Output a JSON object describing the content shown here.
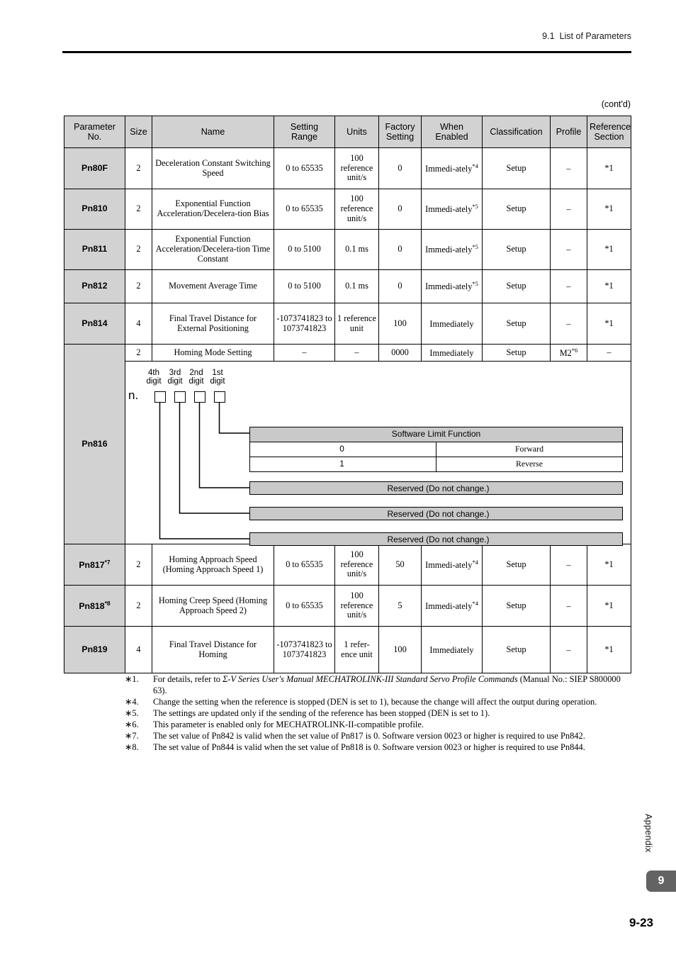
{
  "header": {
    "section_number": "9.1",
    "section_title": "List of Parameters"
  },
  "continued_label": "(cont'd)",
  "table": {
    "columns": [
      "Parameter\nNo.",
      "Size",
      "Name",
      "Setting\nRange",
      "Units",
      "Factory\nSetting",
      "When\nEnabled",
      "Classification",
      "Profile",
      "Reference\nSection"
    ],
    "columns_flat": {
      "parameter_no_line1": "Parameter",
      "parameter_no_line2": "No.",
      "size": "Size",
      "name": "Name",
      "setting_range_line1": "Setting",
      "setting_range_line2": "Range",
      "units": "Units",
      "factory_setting_line1": "Factory",
      "factory_setting_line2": "Setting",
      "when_enabled_line1": "When",
      "when_enabled_line2": "Enabled",
      "classification": "Classification",
      "profile": "Profile",
      "reference_section_line1": "Reference",
      "reference_section_line2": "Section"
    },
    "rows": [
      {
        "parameter_no": "Pn80F",
        "footnote_marker": "",
        "size": "2",
        "name": "Deceleration Constant Switching Speed",
        "setting_range": "0 to 65535",
        "units": "100 reference unit/s",
        "factory_setting": "0",
        "when_enabled": "Immedi-ately",
        "when_enabled_footnote": "*4",
        "classification": "Setup",
        "profile": "–",
        "profile_footnote": "",
        "reference_section": "*1"
      },
      {
        "parameter_no": "Pn810",
        "footnote_marker": "",
        "size": "2",
        "name": "Exponential Function Acceleration/Decelera-tion Bias",
        "setting_range": "0 to 65535",
        "units": "100 reference unit/s",
        "factory_setting": "0",
        "when_enabled": "Immedi-ately",
        "when_enabled_footnote": "*5",
        "classification": "Setup",
        "profile": "–",
        "profile_footnote": "",
        "reference_section": "*1"
      },
      {
        "parameter_no": "Pn811",
        "footnote_marker": "",
        "size": "2",
        "name": "Exponential Function Acceleration/Decelera-tion Time Constant",
        "setting_range": "0 to 5100",
        "units": "0.1 ms",
        "factory_setting": "0",
        "when_enabled": "Immedi-ately",
        "when_enabled_footnote": "*5",
        "classification": "Setup",
        "profile": "–",
        "profile_footnote": "",
        "reference_section": "*1"
      },
      {
        "parameter_no": "Pn812",
        "footnote_marker": "",
        "size": "2",
        "name": "Movement Average Time",
        "setting_range": "0 to 5100",
        "units": "0.1 ms",
        "factory_setting": "0",
        "when_enabled": "Immedi-ately",
        "when_enabled_footnote": "*5",
        "classification": "Setup",
        "profile": "–",
        "profile_footnote": "",
        "reference_section": "*1"
      },
      {
        "parameter_no": "Pn814",
        "footnote_marker": "",
        "size": "4",
        "name": "Final Travel Distance for External Positioning",
        "setting_range": "-1073741823 to 1073741823",
        "units": "1 reference unit",
        "factory_setting": "100",
        "when_enabled": "Immediately",
        "when_enabled_footnote": "",
        "classification": "Setup",
        "profile": "–",
        "profile_footnote": "",
        "reference_section": "*1"
      },
      {
        "parameter_no": "Pn816",
        "footnote_marker": "",
        "size": "2",
        "name": "Homing Mode Setting",
        "setting_range": "–",
        "units": "–",
        "factory_setting": "0000",
        "when_enabled": "Immediately",
        "when_enabled_footnote": "",
        "classification": "Setup",
        "profile": "M2",
        "profile_footnote": "*6",
        "reference_section": "–"
      },
      {
        "parameter_no": "Pn817",
        "footnote_marker": "*7",
        "size": "2",
        "name": "Homing Approach Speed (Homing Approach Speed 1)",
        "setting_range": "0 to 65535",
        "units": "100 reference unit/s",
        "factory_setting": "50",
        "when_enabled": "Immedi-ately",
        "when_enabled_footnote": "*4",
        "classification": "Setup",
        "profile": "–",
        "profile_footnote": "",
        "reference_section": "*1"
      },
      {
        "parameter_no": "Pn818",
        "footnote_marker": "*8",
        "size": "2",
        "name": "Homing Creep Speed (Homing Approach Speed 2)",
        "setting_range": "0 to 65535",
        "units": "100 reference unit/s",
        "factory_setting": "5",
        "when_enabled": "Immedi-ately",
        "when_enabled_footnote": "*4",
        "classification": "Setup",
        "profile": "–",
        "profile_footnote": "",
        "reference_section": "*1"
      },
      {
        "parameter_no": "Pn819",
        "footnote_marker": "",
        "size": "4",
        "name": "Final Travel Distance for Homing",
        "setting_range": "-1073741823 to 1073741823",
        "units": "1 refer-ence unit",
        "factory_setting": "100",
        "when_enabled": "Immediately",
        "when_enabled_footnote": "",
        "classification": "Setup",
        "profile": "–",
        "profile_footnote": "",
        "reference_section": "*1"
      }
    ]
  },
  "digit_diagram": {
    "prefix": "n.",
    "digit_labels": [
      {
        "ordinal": "4th",
        "word": "digit"
      },
      {
        "ordinal": "3rd",
        "word": "digit"
      },
      {
        "ordinal": "2nd",
        "word": "digit"
      },
      {
        "ordinal": "1st",
        "word": "digit"
      }
    ],
    "first_digit": {
      "title": "Software Limit Function",
      "options": [
        {
          "value": "0",
          "description": "Forward"
        },
        {
          "value": "1",
          "description": "Reverse"
        }
      ]
    },
    "second_digit": {
      "title": "Reserved (Do not change.)"
    },
    "third_digit": {
      "title": "Reserved (Do not change.)"
    },
    "fourth_digit": {
      "title": "Reserved (Do not change.)"
    }
  },
  "footnotes": [
    {
      "marker": "∗1.",
      "text_before": "For details, refer to ",
      "italic": "Σ-V Series User's Manual MECHATROLINK-III Standard Servo Profile Commands",
      "text_after": " (Manual No.: SIEP S800000 63)."
    },
    {
      "marker": "∗4.",
      "text_before": "Change the setting when the reference is stopped (DEN is set to 1), because the change will affect the output during operation.",
      "italic": "",
      "text_after": ""
    },
    {
      "marker": "∗5.",
      "text_before": "The settings are updated only if the sending of the reference has been stopped (DEN is set to 1).",
      "italic": "",
      "text_after": ""
    },
    {
      "marker": "∗6.",
      "text_before": "This parameter is enabled only for MECHATROLINK-II-compatible profile.",
      "italic": "",
      "text_after": ""
    },
    {
      "marker": "∗7.",
      "text_before": "The set value of Pn842 is valid when the set value of Pn817 is 0. Software version 0023 or higher is required to use Pn842.",
      "italic": "",
      "text_after": ""
    },
    {
      "marker": "∗8.",
      "text_before": "The set value of Pn844 is valid when the set value of Pn818 is 0. Software version 0023 or higher is required to use Pn844.",
      "italic": "",
      "text_after": ""
    }
  ],
  "sidebar": {
    "appendix_label": "Appendix",
    "chapter_tab": "9",
    "page_number": "9-23"
  },
  "colors": {
    "header_fill": "#d2d2d2",
    "param_fill": "#d2d2d2",
    "subtable_fill": "#c9c9c9",
    "chapter_tab_fill": "#636363",
    "rule": "#000000"
  }
}
